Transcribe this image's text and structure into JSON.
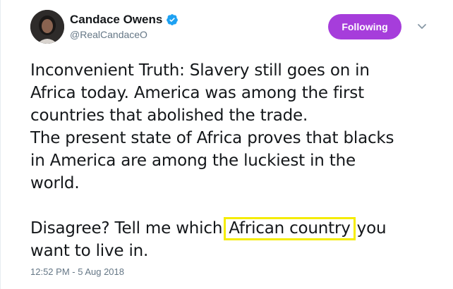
{
  "author": {
    "display_name": "Candace Owens",
    "handle": "@RealCandaceO",
    "verified_icon": "verified-badge-icon",
    "avatar_icon": "profile-avatar"
  },
  "follow_button": {
    "label": "Following",
    "color": "#a63ddb"
  },
  "menu": {
    "icon": "chevron-down-icon"
  },
  "tweet": {
    "lines": [
      "Inconvenient Truth: Slavery still goes on in",
      "Africa today. America was among the first",
      "countries that abolished the trade.",
      "The present state of Africa proves that blacks",
      "in America are among the luckiest in the",
      "world."
    ],
    "closing_before": "Disagree? Tell me which",
    "closing_highlight": "African country",
    "closing_after": "you",
    "closing_last_line": "want to live in.",
    "highlight_color": "#f5ec00"
  },
  "timestamp": "12:52 PM - 5 Aug 2018"
}
